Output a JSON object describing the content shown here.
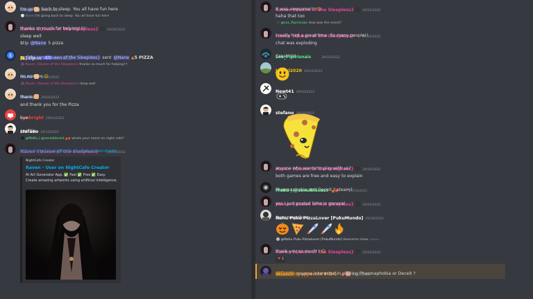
{
  "colors": {
    "raven": "#eb459e",
    "nane": "#7289da",
    "les": "#57f287",
    "joseal": "#f1c40f",
    "hunzah": "#e67e22",
    "link": "#00aff4"
  },
  "left": {
    "m1": {
      "name": "Nane",
      "ts": "29/10/2022",
      "text": "I'm going back to sleep. You all have fun here"
    },
    "m1r": {
      "name": "Nane",
      "text": "I'm going back to sleep. You all have fun here"
    },
    "m2": {
      "name": "Raven {Queen of the Sleepless}",
      "ts": "29/10/2022",
      "l1": "thanks so much for helping!!!!",
      "l2": "sleep well",
      "l3a": "$tip",
      "l3m": "@Nane",
      "l3b": "5 pizza"
    },
    "m3": {
      "name": "[$] tip.cc",
      "bot": "BOT",
      "ts": "29/10/2022",
      "pre": "@Raven {Queen of the Sleepless}",
      "mid": "sent",
      "m": "@Nane",
      "amt": "5 PIZZA"
    },
    "m3r": {
      "name": "Raven {Queen of the Sleepless}",
      "text": "thanks so much for helping!!!"
    },
    "m4": {
      "name": "Nane",
      "ts": "29/10/2022",
      "text": "no worries"
    },
    "m4r": {
      "name": "Raven {Queen of the Sleepless}",
      "text": "sleep well"
    },
    "m5": {
      "name": "Nane",
      "ts": "29/10/2022",
      "l1": "thanks",
      "l2": "and thank you for the Pizza"
    },
    "m6": {
      "name": "sunbright",
      "ts": "29/10/2022",
      "text": "bye"
    },
    "m7": {
      "name": "stefano",
      "ts": "29/10/2022",
      "text": "cool tip"
    },
    "m8r": {
      "name": "@MeBu | @sensiblecast",
      "text": "whats your name on night cafe?"
    },
    "m8": {
      "name": "Raven {Queen of the Sleepless}",
      "ts": "29/10/2022",
      "link": "https://creator.nightcafe.studio/u/ravenmusic"
    },
    "embed": {
      "site": "NightCafe Creator",
      "title": "Raven - User on NightCafe Creator",
      "d1": "AI Art Generator App. ✅ Fast ✅ Free ✅ Easy.",
      "d2": "Create amazing artworks using artificial intelligence."
    }
  },
  "right": {
    "r1": {
      "name": "Raven {Queen of the Sleepless}",
      "ts": "29/10/2022",
      "l1": "It was awesome!!!",
      "l2": "haha that too"
    },
    "r2r": {
      "name": "@Les_Pipirisnais",
      "text": "How was the event?"
    },
    "r2": {
      "name": "Raven {Queen of the Sleepless}",
      "ts": "29/10/2022",
      "l1": "I really had a great time. So many people!!",
      "l2": "chat was exploding"
    },
    "r3": {
      "name": "Les_Pipirisnais",
      "ts": "29/10/2022",
      "text": "Great!!!!!"
    },
    "r4": {
      "name": "Joseal2020",
      "ts": "29/10/2022"
    },
    "r5": {
      "name": "Newt41",
      "ts": "29/10/2022"
    },
    "r6": {
      "name": "stefano",
      "ts": "29/10/2022"
    },
    "r7": {
      "name": "Raven {Queen of the Sleepless}",
      "ts": "29/10/2022",
      "l1": "anyone who wants to play with us?",
      "l2": "both games are free and easy to explain"
    },
    "r8": {
      "name": "MeBu | @sensiblecast",
      "ts": "29/10/2022",
      "text": "Phasmaphobia and Deceit ? steam?"
    },
    "r9": {
      "name": "Raven {Queen of the Sleepless}",
      "ts": "29/10/2022",
      "text": "yes i just posted links in general"
    },
    "r10": {
      "name": "Nahu Puku PizzaLover [PukuMundo]",
      "ts": "29/10/2022",
      "text": "Awesome show",
      "edited": "(edited)"
    },
    "r11r": {
      "name": "@Nahu Puku PizzaLover [PukuMundo]",
      "text": "Awesome show",
      "edited": "(edited)"
    },
    "r11": {
      "name": "Raven {Queen of the Sleepless}",
      "ts": "29/10/2022",
      "text": "thank you so much !",
      "react": "1"
    },
    "r12": {
      "name": "Huzzah {pepperoni สำนัก}",
      "ts": "29/10/2022",
      "m": "@Everto",
      "text": "anyone interested in playing Phasmaphobia or Deceit ?"
    }
  }
}
